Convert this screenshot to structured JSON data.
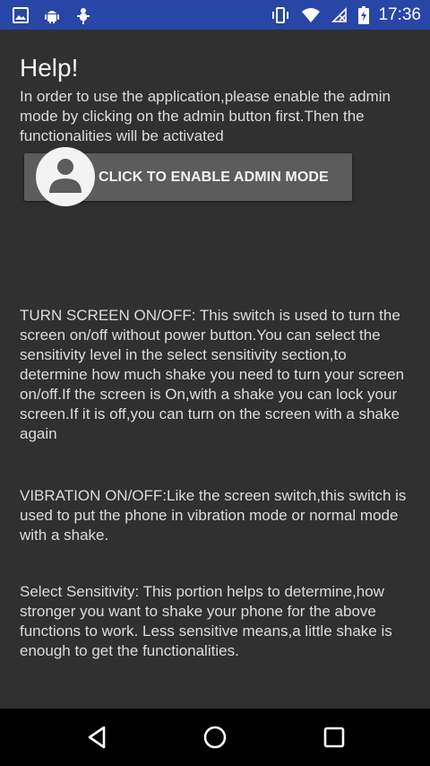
{
  "status_bar": {
    "time": "17:36",
    "left_icons": [
      "image-icon",
      "android-icon",
      "bug-icon"
    ],
    "right_icons": [
      "vibrate-icon",
      "wifi-icon",
      "no-signal-icon",
      "battery-charging-icon"
    ],
    "background": "#2846a5"
  },
  "help": {
    "title": "Help!",
    "intro": "In order to use the application,please enable the admin mode by clicking on the admin button first.Then the functionalities will be activated"
  },
  "admin_button": {
    "label": "CLICK TO ENABLE ADMIN MODE",
    "icon": "person-icon"
  },
  "sections": {
    "screen": "TURN SCREEN ON/OFF: This switch is used to turn the screen on/off without power button.You can select the sensitivity level in the select sensitivity section,to determine how much shake you need to turn your screen on/off.If the screen is On,with a shake you can lock your screen.If it is off,you can turn on the screen with a shake again",
    "vibration": "VIBRATION ON/OFF:Like the screen switch,this switch is used to put the phone in vibration mode or normal mode with a shake.",
    "sensitivity": "Select Sensitivity: This portion helps to determine,how stronger you want to shake your phone for the above functions to work. Less sensitive means,a little shake is enough to get the functionalities."
  },
  "nav_bar": {
    "icons": [
      "back-icon",
      "home-icon",
      "recents-icon"
    ]
  }
}
